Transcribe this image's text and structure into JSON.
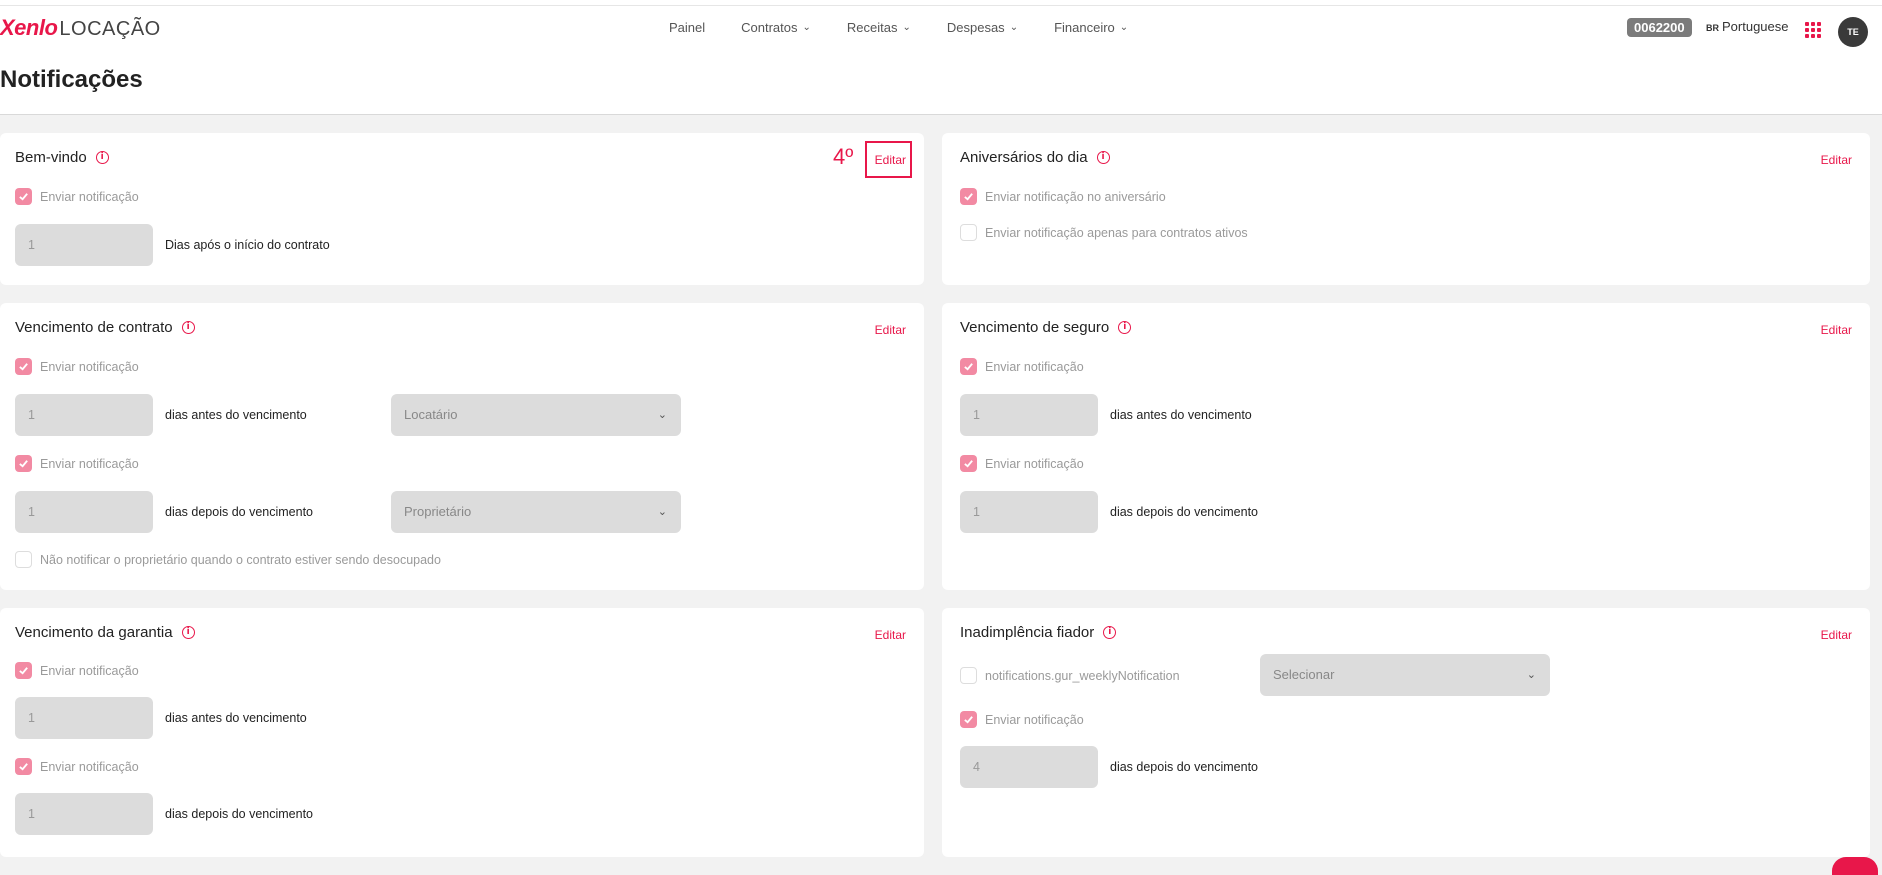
{
  "header": {
    "logo_mark": "Xenlo",
    "logo_sub": "LOCAÇÃO",
    "nav": [
      {
        "label": "Painel",
        "has_dropdown": false
      },
      {
        "label": "Contratos",
        "has_dropdown": true
      },
      {
        "label": "Receitas",
        "has_dropdown": true
      },
      {
        "label": "Despesas",
        "has_dropdown": true
      },
      {
        "label": "Financeiro",
        "has_dropdown": true
      }
    ],
    "code_badge": "0062200",
    "lang_flag": "BR",
    "lang_label": "Portuguese",
    "avatar_initials": "TE"
  },
  "page": {
    "title": "Notificações"
  },
  "annotation": {
    "step": "4º"
  },
  "cards": {
    "bem_vindo": {
      "title": "Bem-vindo",
      "edit": "Editar",
      "check_label": "Enviar notificação",
      "days_value": "1",
      "days_label": "Dias após o início do contrato"
    },
    "aniversarios": {
      "title": "Aniversários do dia",
      "edit": "Editar",
      "check1_label": "Enviar notificação no aniversário",
      "check2_label": "Enviar notificação apenas para contratos ativos"
    },
    "venc_contrato": {
      "title": "Vencimento de contrato",
      "edit": "Editar",
      "check1_label": "Enviar notificação",
      "before_value": "1",
      "before_label": "dias antes do vencimento",
      "select1": "Locatário",
      "check2_label": "Enviar notificação",
      "after_value": "1",
      "after_label": "dias depois do vencimento",
      "select2": "Proprietário",
      "check3_label": "Não notificar o proprietário quando o contrato estiver sendo desocupado"
    },
    "venc_seguro": {
      "title": "Vencimento de seguro",
      "edit": "Editar",
      "check1_label": "Enviar notificação",
      "before_value": "1",
      "before_label": "dias antes do vencimento",
      "check2_label": "Enviar notificação",
      "after_value": "1",
      "after_label": "dias depois do vencimento"
    },
    "venc_garantia": {
      "title": "Vencimento da garantia",
      "edit": "Editar",
      "check1_label": "Enviar notificação",
      "before_value": "1",
      "before_label": "dias antes do vencimento",
      "check2_label": "Enviar notificação",
      "after_value": "1",
      "after_label": "dias depois do vencimento"
    },
    "inadimplencia": {
      "title": "Inadimplência fiador",
      "edit": "Editar",
      "check1_label": "notifications.gur_weeklyNotification",
      "select1": "Selecionar",
      "check2_label": "Enviar notificação",
      "after_value": "4",
      "after_label": "dias depois do vencimento"
    }
  },
  "colors": {
    "accent": "#e8174a",
    "checkbox": "#f28aa3",
    "background": "#f2f2f2"
  }
}
